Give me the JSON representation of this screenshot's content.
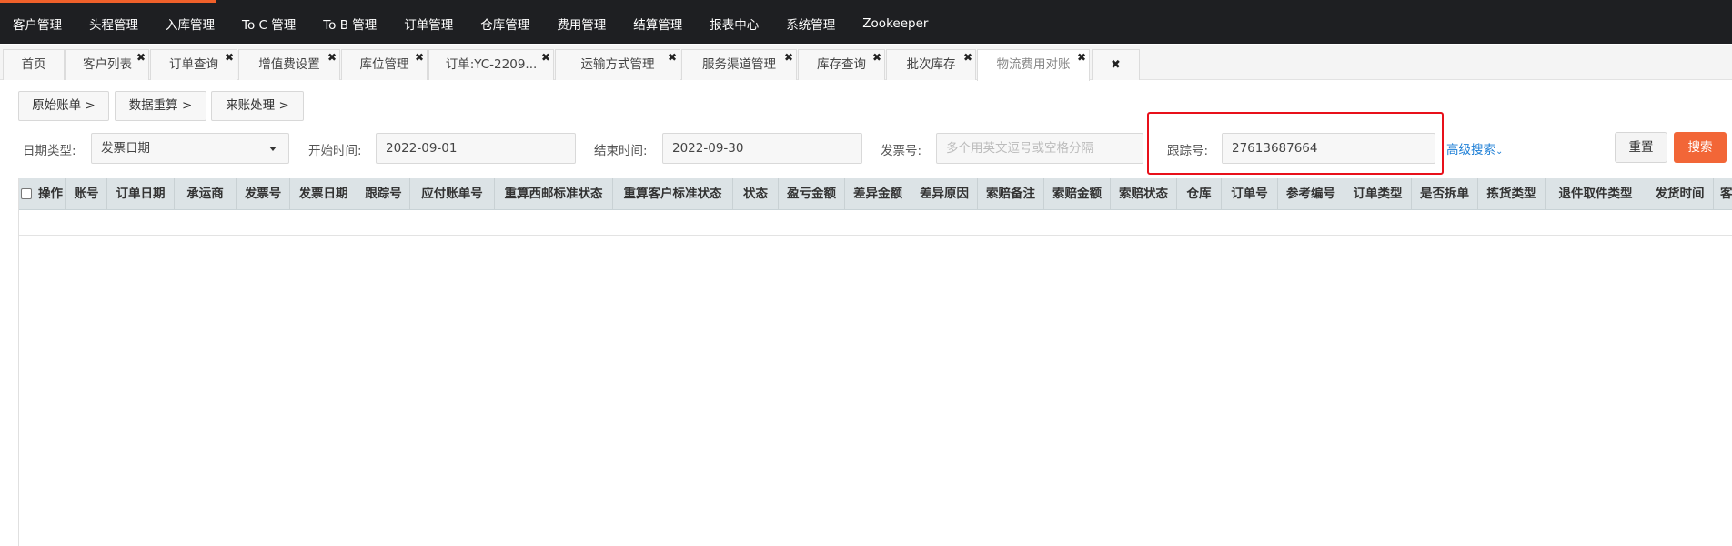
{
  "topnav": {
    "items": [
      "客户管理",
      "头程管理",
      "入库管理",
      "To C 管理",
      "To B 管理",
      "订单管理",
      "仓库管理",
      "费用管理",
      "结算管理",
      "报表中心",
      "系统管理",
      "Zookeeper"
    ]
  },
  "tabs": [
    {
      "label": "首页",
      "closable": false
    },
    {
      "label": "客户列表",
      "closable": true
    },
    {
      "label": "订单查询",
      "closable": true
    },
    {
      "label": "增值费设置",
      "closable": true
    },
    {
      "label": "库位管理",
      "closable": true
    },
    {
      "label": "订单:YC-2209...",
      "closable": true
    },
    {
      "label": "运输方式管理",
      "closable": true
    },
    {
      "label": "服务渠道管理",
      "closable": true
    },
    {
      "label": "库存查询",
      "closable": true
    },
    {
      "label": "批次库存",
      "closable": true
    },
    {
      "label": "物流费用对账",
      "closable": true,
      "active": true
    }
  ],
  "tab_close_all_icon": "close-icon",
  "steps": [
    "原始账单 >",
    "数据重算 >",
    "来账处理 >"
  ],
  "filters": {
    "date_type_label": "日期类型:",
    "date_type_value": "发票日期",
    "start_label": "开始时间:",
    "start_value": "2022-09-01",
    "end_label": "结束时间:",
    "end_value": "2022-09-30",
    "invoice_label": "发票号:",
    "invoice_placeholder": "多个用英文逗号或空格分隔",
    "tracking_label": "跟踪号:",
    "tracking_value": "27613687664",
    "advanced_label": "高级搜索",
    "reset_label": "重置",
    "search_label": "搜索"
  },
  "highlight_color": "#e8101a",
  "accent_color": "#f26637",
  "table": {
    "columns": [
      "操作",
      "账号",
      "订单日期",
      "承运商",
      "发票号",
      "发票日期",
      "跟踪号",
      "应付账单号",
      "重算西邮标准状态",
      "重算客户标准状态",
      "状态",
      "盈亏金额",
      "差异金额",
      "差异原因",
      "索赔备注",
      "索赔金额",
      "索赔状态",
      "仓库",
      "订单号",
      "参考编号",
      "订单类型",
      "是否拆单",
      "拣货类型",
      "退件取件类型",
      "发货时间",
      "客户"
    ],
    "rows": []
  }
}
